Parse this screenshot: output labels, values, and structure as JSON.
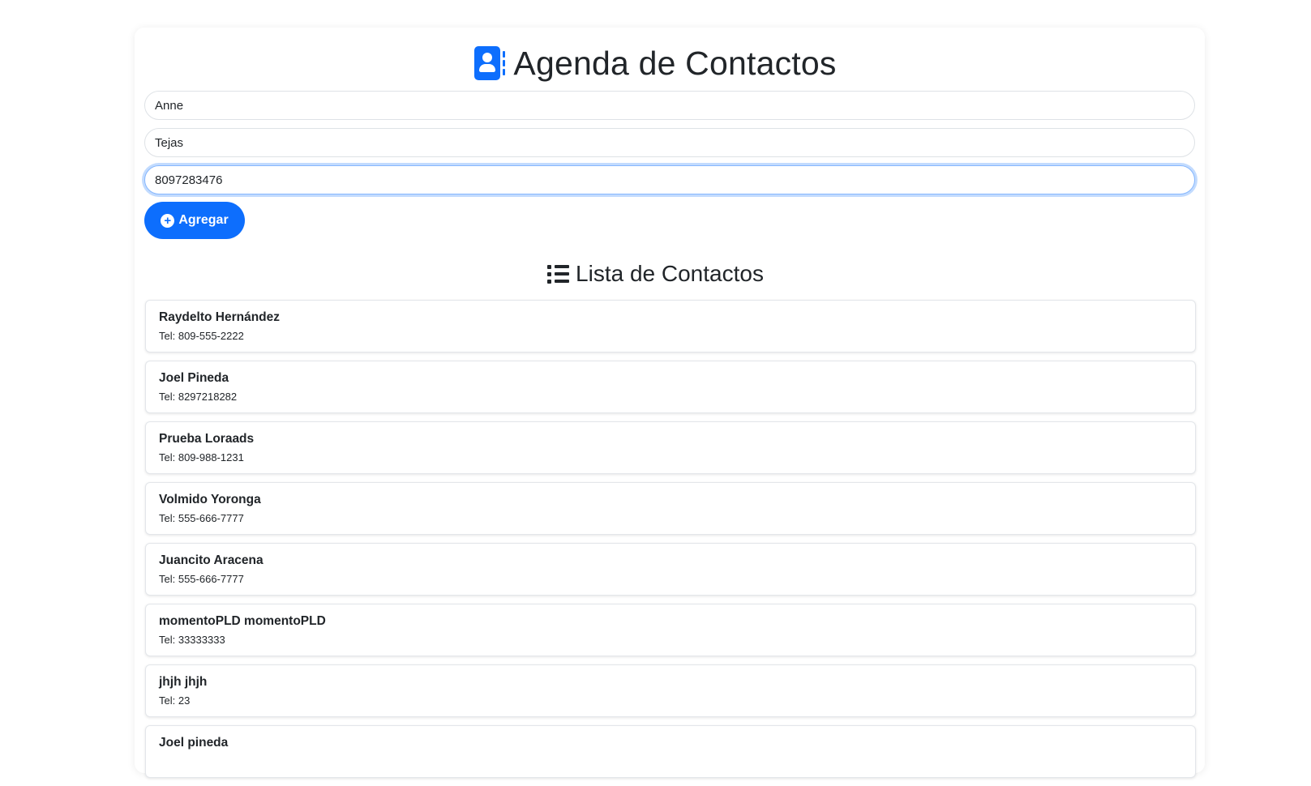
{
  "header": {
    "title": "Agenda de Contactos",
    "icon": "address-book-icon",
    "icon_color": "#0d6efd"
  },
  "form": {
    "first_name_value": "Anne",
    "last_name_value": "Tejas",
    "phone_value": "8097283476",
    "add_button_label": "Agregar",
    "add_button_icon": "plus-circle-icon",
    "accent_color": "#0d6efd"
  },
  "list": {
    "title": "Lista de Contactos",
    "icon": "list-icon",
    "contacts": [
      {
        "name": "Raydelto Hernández",
        "phone": "Tel: 809-555-2222"
      },
      {
        "name": "Joel Pineda",
        "phone": "Tel: 8297218282"
      },
      {
        "name": "Prueba Loraads",
        "phone": "Tel: 809-988-1231"
      },
      {
        "name": "Volmido Yoronga",
        "phone": "Tel: 555-666-7777"
      },
      {
        "name": "Juancito Aracena",
        "phone": "Tel: 555-666-7777"
      },
      {
        "name": "momentoPLD momentoPLD",
        "phone": "Tel: 33333333"
      },
      {
        "name": "jhjh jhjh",
        "phone": "Tel: 23"
      },
      {
        "name": "Joel pineda",
        "phone": ""
      }
    ]
  }
}
